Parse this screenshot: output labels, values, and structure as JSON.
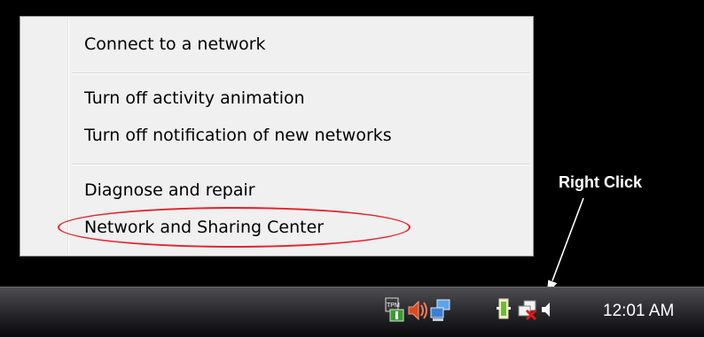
{
  "menu": {
    "items": [
      {
        "label": "Connect to a network"
      },
      {
        "label": "Turn off activity animation"
      },
      {
        "label": "Turn off notification of new networks"
      },
      {
        "label": "Diagnose and repair"
      },
      {
        "label": "Network and Sharing Center"
      }
    ]
  },
  "annotation": {
    "callout": "Right Click",
    "highlight_color": "#e8202a"
  },
  "tray": {
    "icons": [
      "tpm-icon",
      "speaker-alert-icon",
      "network-computers-icon",
      "power-plug-icon",
      "network-disconnected-icon",
      "volume-icon"
    ],
    "tpm_label": "TPM",
    "clock": "12:01 AM"
  }
}
